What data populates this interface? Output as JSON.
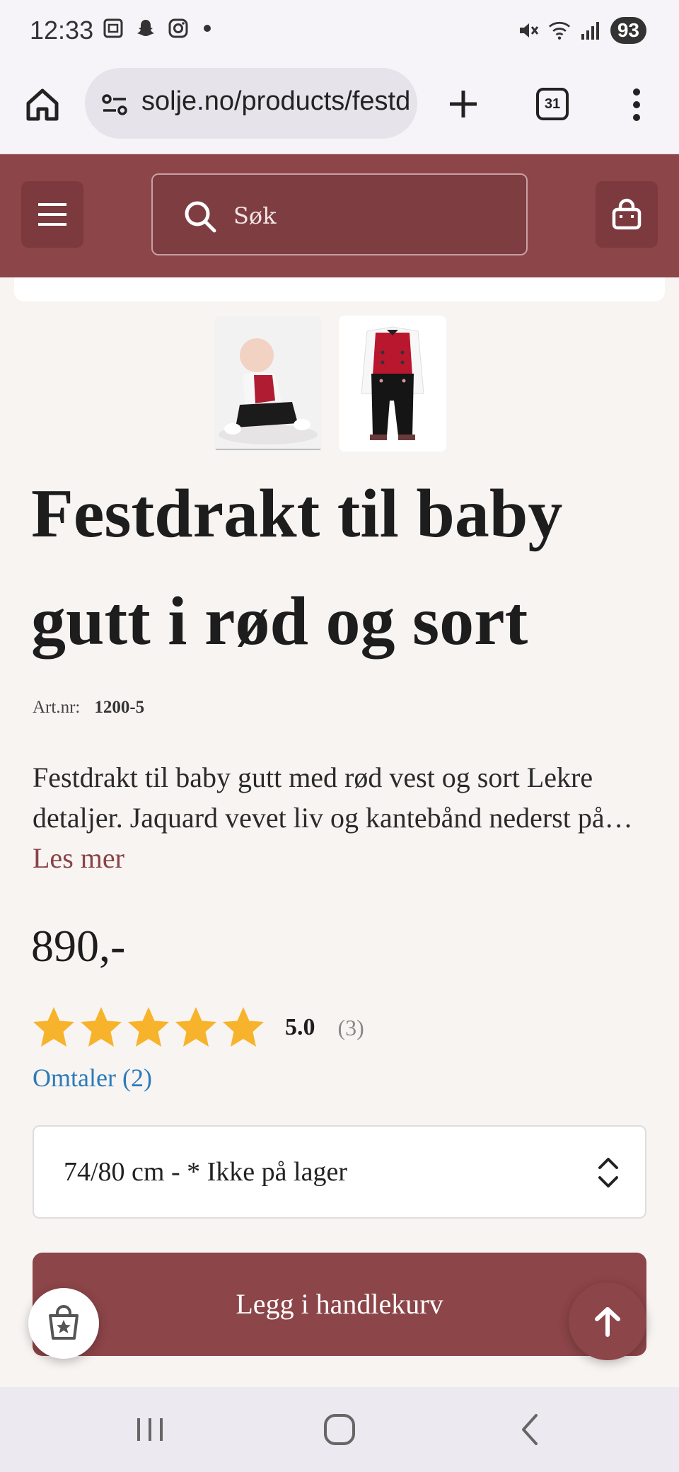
{
  "status_bar": {
    "time": "12:33",
    "battery": "93"
  },
  "browser": {
    "url": "solje.no/products/festdrakt",
    "tab_count": "31"
  },
  "header": {
    "search_placeholder": "Søk"
  },
  "product": {
    "title": "Festdrakt til baby gutt i rød og sort",
    "art_label": "Art.nr:",
    "art_number": "1200-5",
    "description": "Festdrakt til baby gutt med rød vest og sort Lekre detaljer. Jaquard vevet liv og kantebånd nederst på buksen.",
    "read_more": "Les mer",
    "price": "890,-",
    "rating": {
      "value": "5.0",
      "count": "(3)",
      "stars": 5
    },
    "reviews_link": "Omtaler (2)",
    "size_selected": "74/80 cm - * Ikke på lager",
    "add_to_cart": "Legg i handlekurv"
  },
  "colors": {
    "brand": "#8c4549",
    "star": "#f7b32b",
    "link": "#2b7bb9"
  }
}
